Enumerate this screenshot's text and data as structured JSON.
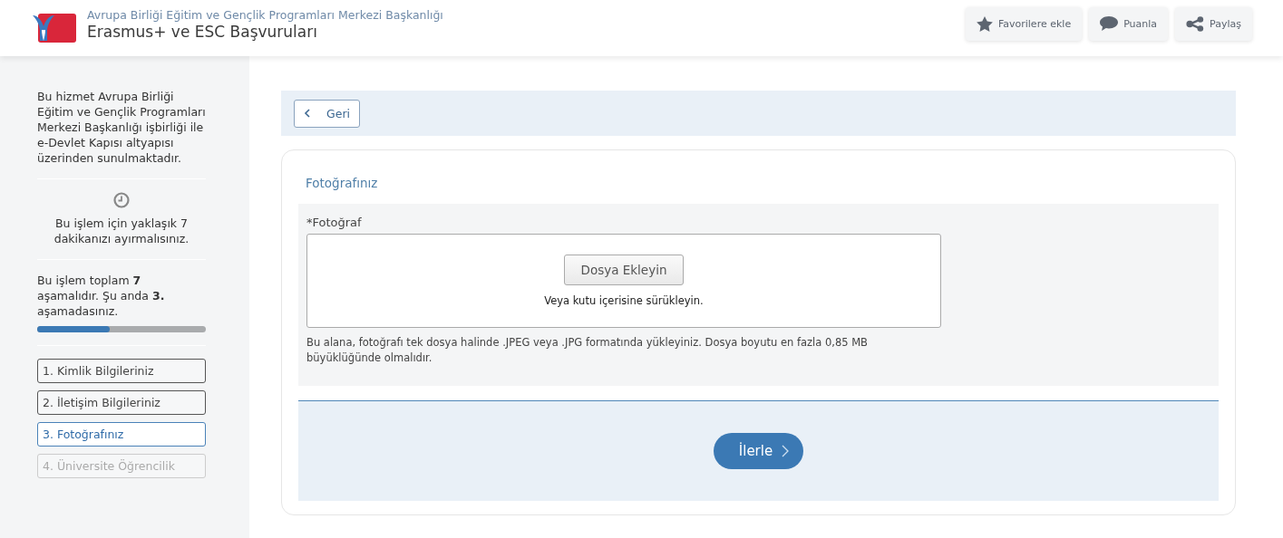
{
  "header": {
    "agency": "Avrupa Birliği Eğitim ve Gençlik Programları Merkezi Başkanlığı",
    "title": "Erasmus+ ve ESC Başvuruları",
    "actions": [
      {
        "kind": "star",
        "label": "Favorilere ekle"
      },
      {
        "kind": "comment",
        "label": "Puanla"
      },
      {
        "kind": "share",
        "label": "Paylaş"
      }
    ]
  },
  "sidebar": {
    "info": "Bu hizmet Avrupa Birliği Eğitim ve Gençlik Programları Merkezi Başkanlığı işbirliği ile e-Devlet Kapısı altyapısı üzerinden sunulmaktadır.",
    "duration": "Bu işlem için yaklaşık 7 dakikanızı ayırmalısınız.",
    "progress_text": "Bu işlem toplam **7** aşamalıdır. Şu anda **3.** aşamadasınız.",
    "progress": {
      "level": 0.43
    },
    "steps": [
      {
        "label": "1. Kimlik Bilgileriniz",
        "selected": false,
        "disabled": false
      },
      {
        "label": "2. İletişim Bilgileriniz",
        "selected": false,
        "disabled": false
      },
      {
        "label": "3. Fotoğrafınız",
        "selected": true,
        "disabled": false
      },
      {
        "label": "4. Üniversite Öğrencilik",
        "selected": false,
        "disabled": true
      }
    ]
  },
  "back_button": "Geri",
  "form": {
    "title": "Fotoğrafınız",
    "field_label": "*Fotoğraf",
    "upload_button": "Dosya Ekleyin",
    "drop_hint": "Veya kutu içerisine sürükleyin.",
    "help": "Bu alana, fotoğrafı tek dosya halinde .JPEG veya .JPG formatında yükleyiniz. Dosya boyutu en fazla 0,85 MB büyüklüğünde olmalıdır.",
    "next_button": "İlerle"
  }
}
